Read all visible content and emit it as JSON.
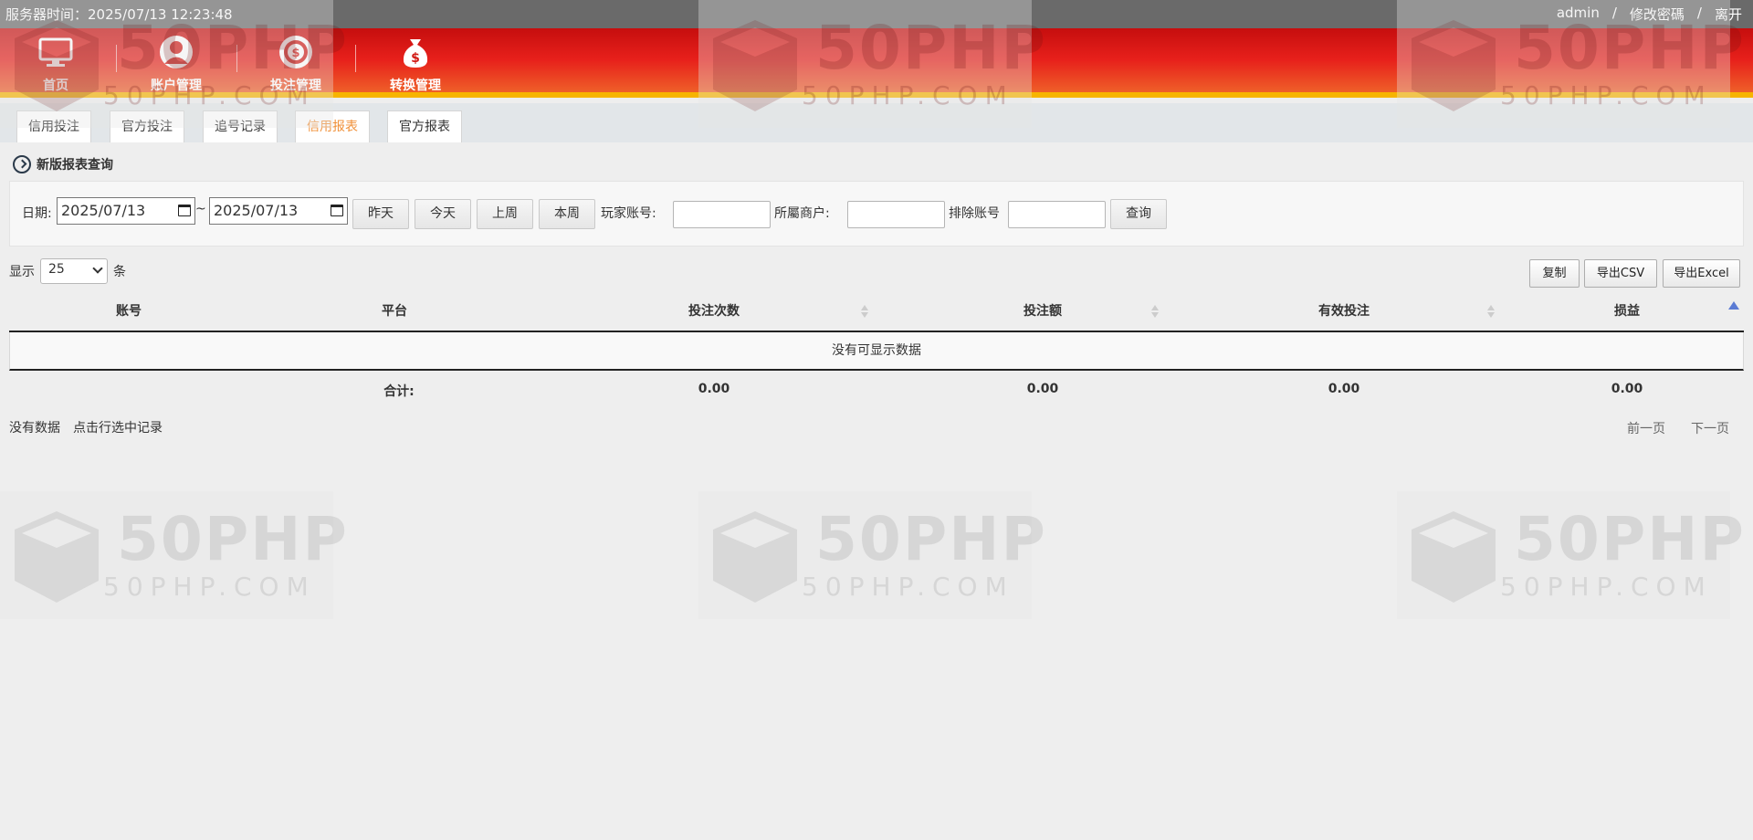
{
  "topbar": {
    "server_time": "服务器时间：2025/07/13 12:23:48",
    "user": "admin",
    "sep": "/",
    "change_password": "修改密碼",
    "logout": "离开"
  },
  "nav": {
    "items": [
      {
        "label": "首页",
        "icon": "monitor-icon"
      },
      {
        "label": "账户管理",
        "icon": "user-icon"
      },
      {
        "label": "投注管理",
        "icon": "chip-icon"
      },
      {
        "label": "转换管理",
        "icon": "money-bag-icon"
      }
    ],
    "active": "投注管理",
    "colors": {
      "header_top": "#c60e0e",
      "header_bottom": "#f06a2b",
      "stripe": "#f7b400"
    }
  },
  "subtabs": [
    {
      "label": "信用投注"
    },
    {
      "label": "官方投注"
    },
    {
      "label": "追号记录"
    },
    {
      "label": "信用报表"
    },
    {
      "label": "官方报表"
    }
  ],
  "active_subtab": "信用报表",
  "section_title": "新版报表查询",
  "filter": {
    "date_label": "日期:",
    "date_from": "2025/07/13",
    "tilde": "~",
    "date_to": "2025/07/13",
    "yesterday": "昨天",
    "today": "今天",
    "last_week": "上周",
    "this_week": "本周",
    "player_label": "玩家账号:",
    "merchant_label": "所屬商户:",
    "exclude_label": "排除账号",
    "query": "查询"
  },
  "table_toolbar": {
    "show_label": "显示",
    "page_size": "25",
    "unit": "条",
    "copy": "复制",
    "export_csv": "导出CSV",
    "export_excel": "导出Excel"
  },
  "table": {
    "columns": [
      "账号",
      "平台",
      "投注次数",
      "投注额",
      "有效投注",
      "损益"
    ],
    "empty_message": "没有可显示数据",
    "footer": {
      "label": "合计:",
      "bet_count": "0.00",
      "bet_amount": "0.00",
      "valid_bet": "0.00",
      "profit": "0.00"
    }
  },
  "status": {
    "info": "没有数据",
    "hint": "点击行选中记录"
  },
  "pager": {
    "prev": "前一页",
    "next": "下一页"
  },
  "watermark": {
    "big": "50PHP",
    "small": "50PHP.COM"
  }
}
